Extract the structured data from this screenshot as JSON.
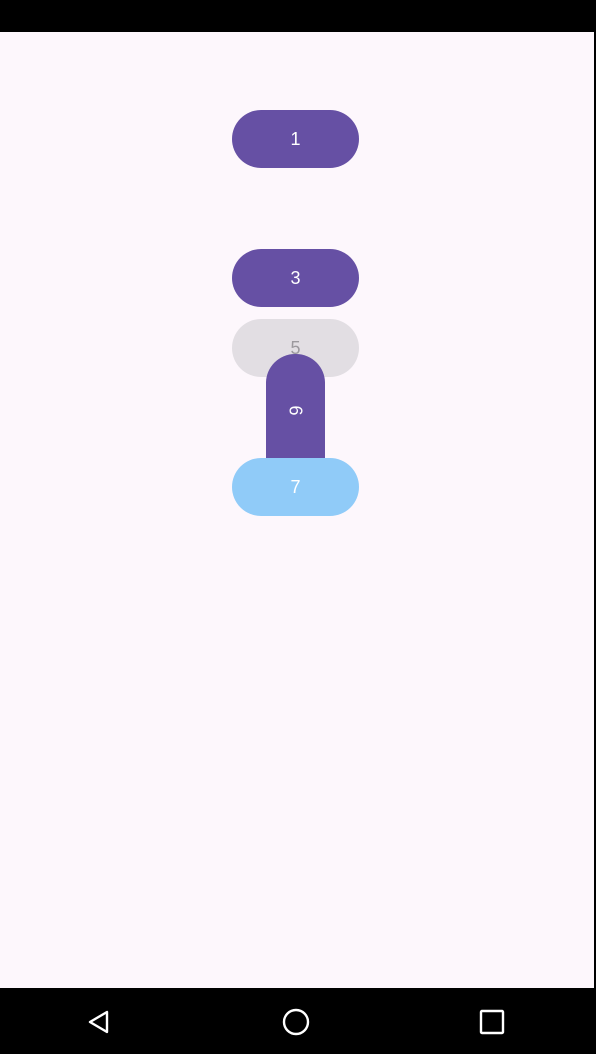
{
  "buttons": [
    {
      "label": "1",
      "color": "#6650a4",
      "text_color": "#ffffff",
      "enabled": true
    },
    {
      "label": "3",
      "color": "#6650a4",
      "text_color": "#ffffff",
      "enabled": true
    },
    {
      "label": "5",
      "color": "#e2dee3",
      "text_color": "#9c999e",
      "enabled": false
    },
    {
      "label": "6",
      "color": "#6650a4",
      "text_color": "#ffffff",
      "rotated": true
    },
    {
      "label": "7",
      "color": "#90cbf8",
      "text_color": "#ffffff",
      "enabled": true
    }
  ],
  "background_color": "#fdf7fc",
  "nav_bar": {
    "icons": [
      "back-icon",
      "home-icon",
      "recents-icon"
    ]
  }
}
